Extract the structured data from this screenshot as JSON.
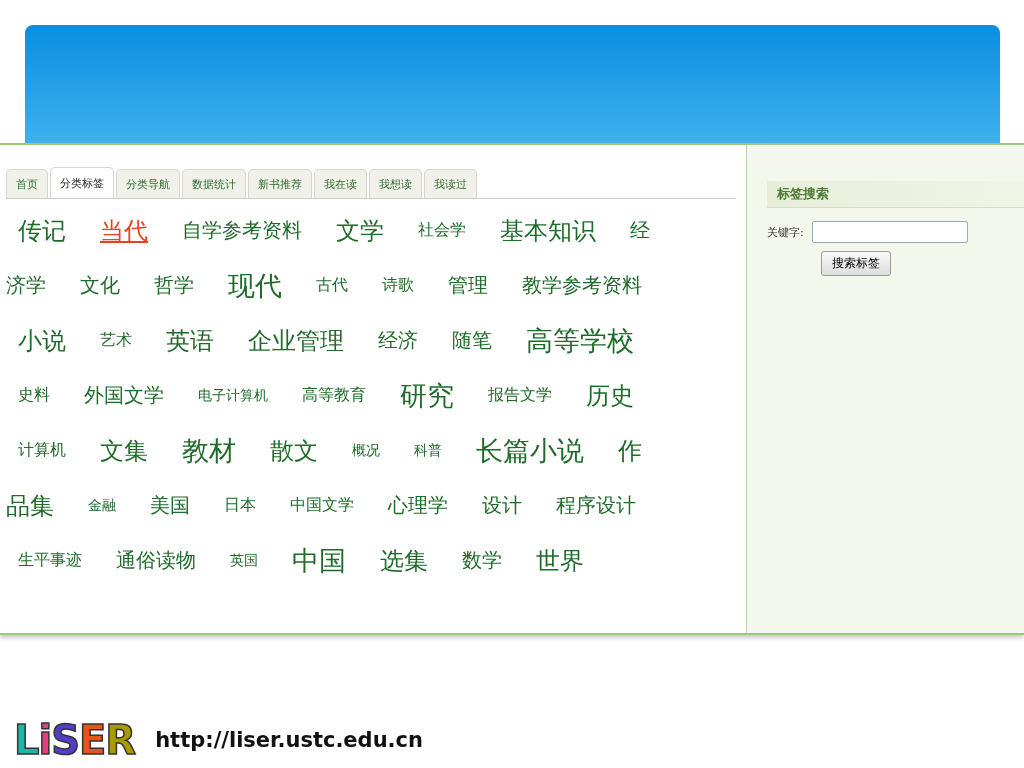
{
  "tabs": [
    {
      "label": "首页",
      "selected": false
    },
    {
      "label": "分类标签",
      "selected": true
    },
    {
      "label": "分类导航",
      "selected": false
    },
    {
      "label": "数据统计",
      "selected": false
    },
    {
      "label": "新书推荐",
      "selected": false
    },
    {
      "label": "我在读",
      "selected": false
    },
    {
      "label": "我想读",
      "selected": false
    },
    {
      "label": "我读过",
      "selected": false
    }
  ],
  "tag_rows": [
    [
      {
        "label": "传记",
        "kind": "large",
        "highlighted": false
      },
      {
        "label": "当代",
        "kind": "large",
        "highlighted": true
      },
      {
        "label": "自学参考资料",
        "kind": "medium",
        "highlighted": false
      },
      {
        "label": "文学",
        "kind": "large",
        "highlighted": false
      },
      {
        "label": "社会学",
        "kind": "small",
        "highlighted": false
      },
      {
        "label": "基本知识",
        "kind": "large",
        "highlighted": false
      },
      {
        "label": "经",
        "kind": "medium",
        "highlighted": false
      }
    ],
    [
      {
        "label": "济学",
        "kind": "medium",
        "highlighted": false
      },
      {
        "label": "文化",
        "kind": "medium",
        "highlighted": false
      },
      {
        "label": "哲学",
        "kind": "medium",
        "highlighted": false
      },
      {
        "label": "现代",
        "kind": "xlarge",
        "highlighted": false
      },
      {
        "label": "古代",
        "kind": "small",
        "highlighted": false
      },
      {
        "label": "诗歌",
        "kind": "small",
        "highlighted": false
      },
      {
        "label": "管理",
        "kind": "medium",
        "highlighted": false
      },
      {
        "label": "教学参考资料",
        "kind": "medium",
        "highlighted": false
      }
    ],
    [
      {
        "label": "小说",
        "kind": "large",
        "highlighted": false
      },
      {
        "label": "艺术",
        "kind": "small",
        "highlighted": false
      },
      {
        "label": "英语",
        "kind": "large",
        "highlighted": false
      },
      {
        "label": "企业管理",
        "kind": "large",
        "highlighted": false
      },
      {
        "label": "经济",
        "kind": "medium",
        "highlighted": false
      },
      {
        "label": "随笔",
        "kind": "medium",
        "highlighted": false
      },
      {
        "label": "高等学校",
        "kind": "xlarge",
        "highlighted": false
      }
    ],
    [
      {
        "label": "史料",
        "kind": "small",
        "highlighted": false
      },
      {
        "label": "外国文学",
        "kind": "medium",
        "highlighted": false
      },
      {
        "label": "电子计算机",
        "kind": "tiny",
        "highlighted": false
      },
      {
        "label": "高等教育",
        "kind": "small",
        "highlighted": false
      },
      {
        "label": "研究",
        "kind": "xlarge",
        "highlighted": false
      },
      {
        "label": "报告文学",
        "kind": "small",
        "highlighted": false
      },
      {
        "label": "历史",
        "kind": "large",
        "highlighted": false
      }
    ],
    [
      {
        "label": "计算机",
        "kind": "small",
        "highlighted": false
      },
      {
        "label": "文集",
        "kind": "large",
        "highlighted": false
      },
      {
        "label": "教材",
        "kind": "xlarge",
        "highlighted": false
      },
      {
        "label": "散文",
        "kind": "large",
        "highlighted": false
      },
      {
        "label": "概况",
        "kind": "tiny",
        "highlighted": false
      },
      {
        "label": "科普",
        "kind": "tiny",
        "highlighted": false
      },
      {
        "label": "长篇小说",
        "kind": "xlarge",
        "highlighted": false
      },
      {
        "label": "作",
        "kind": "large",
        "highlighted": false
      }
    ],
    [
      {
        "label": "品集",
        "kind": "large",
        "highlighted": false
      },
      {
        "label": "金融",
        "kind": "tiny",
        "highlighted": false
      },
      {
        "label": "美国",
        "kind": "medium",
        "highlighted": false
      },
      {
        "label": "日本",
        "kind": "small",
        "highlighted": false
      },
      {
        "label": "中国文学",
        "kind": "small",
        "highlighted": false
      },
      {
        "label": "心理学",
        "kind": "medium",
        "highlighted": false
      },
      {
        "label": "设计",
        "kind": "medium",
        "highlighted": false
      },
      {
        "label": "程序设计",
        "kind": "medium",
        "highlighted": false
      }
    ],
    [
      {
        "label": "生平事迹",
        "kind": "small",
        "highlighted": false
      },
      {
        "label": "通俗读物",
        "kind": "medium",
        "highlighted": false
      },
      {
        "label": "英国",
        "kind": "tiny",
        "highlighted": false
      },
      {
        "label": "中国",
        "kind": "xlarge",
        "highlighted": false
      },
      {
        "label": "选集",
        "kind": "large",
        "highlighted": false
      },
      {
        "label": "数学",
        "kind": "medium",
        "highlighted": false
      },
      {
        "label": "世界",
        "kind": "large",
        "highlighted": false
      }
    ]
  ],
  "sidebar": {
    "title": "标签搜索",
    "field_label": "关键字:",
    "button": "搜索标签"
  },
  "footer": {
    "logo": "LiSER",
    "url": "http://liser.ustc.edu.cn"
  }
}
